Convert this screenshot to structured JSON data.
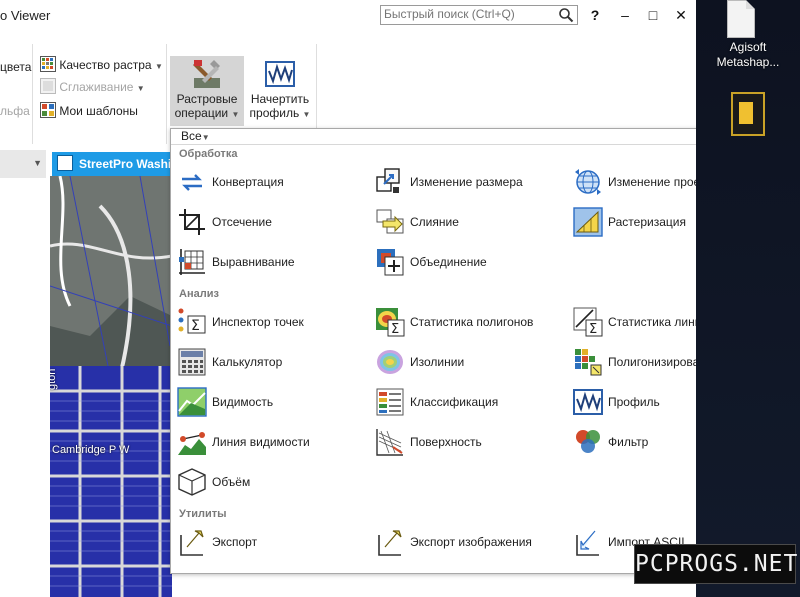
{
  "window": {
    "title": "o Viewer"
  },
  "search": {
    "placeholder": "Быстрый поиск (Ctrl+Q)"
  },
  "window_controls": {
    "help": "?",
    "minimize": "–",
    "maximize": "□",
    "close": "✕"
  },
  "ribbon": {
    "left_partial": {
      "colors": "цвета",
      "alpha": "льфа"
    },
    "raster_quality": "Качество растра",
    "smoothing": "Сглаживание",
    "my_templates": "Мои шаблоны",
    "raster_ops": {
      "line1": "Растровые",
      "line2": "операции"
    },
    "draw_profile": {
      "line1": "Начертить",
      "line2": "профиль"
    }
  },
  "map": {
    "tab": "StreetPro Washi",
    "street_labels": [
      "Cambridge P W",
      "gton"
    ]
  },
  "menu": {
    "filter": "Все",
    "sections": [
      {
        "title": "Обработка",
        "items": [
          {
            "label": "Конвертация",
            "icon": "convert-icon"
          },
          {
            "label": "Изменение размера",
            "icon": "resize-icon"
          },
          {
            "label": "Изменение проекции",
            "icon": "reproject-icon"
          },
          {
            "label": "Отсечение",
            "icon": "clip-icon"
          },
          {
            "label": "Слияние",
            "icon": "merge-icon"
          },
          {
            "label": "Растеризация",
            "icon": "rasterize-icon"
          },
          {
            "label": "Выравнивание",
            "icon": "align-icon"
          },
          {
            "label": "Объединение",
            "icon": "combine-icon"
          }
        ]
      },
      {
        "title": "Анализ",
        "items": [
          {
            "label": "Инспектор точек",
            "icon": "point-inspector-icon"
          },
          {
            "label": "Статистика полигонов",
            "icon": "polygon-stats-icon"
          },
          {
            "label": "Статистика линий",
            "icon": "line-stats-icon"
          },
          {
            "label": "Калькулятор",
            "icon": "calculator-icon"
          },
          {
            "label": "Изолинии",
            "icon": "contours-icon"
          },
          {
            "label": "Полигонизировать",
            "icon": "polygonize-icon"
          },
          {
            "label": "Видимость",
            "icon": "viewshed-icon"
          },
          {
            "label": "Классификация",
            "icon": "classify-icon"
          },
          {
            "label": "Профиль",
            "icon": "profile-icon"
          },
          {
            "label": "Линия видимости",
            "icon": "line-of-sight-icon"
          },
          {
            "label": "Поверхность",
            "icon": "surface-icon"
          },
          {
            "label": "Фильтр",
            "icon": "filter-icon"
          },
          {
            "label": "Объём",
            "icon": "volume-icon"
          }
        ]
      },
      {
        "title": "Утилиты",
        "items": [
          {
            "label": "Экспорт",
            "icon": "export-icon"
          },
          {
            "label": "Экспорт изображения",
            "icon": "export-image-icon"
          },
          {
            "label": "Импорт ASCII",
            "icon": "import-ascii-icon"
          }
        ]
      }
    ]
  },
  "desktop": {
    "icon_label_1": "Agisoft",
    "icon_label_2": "Metashap..."
  },
  "watermark": "PCPROGS.NET"
}
